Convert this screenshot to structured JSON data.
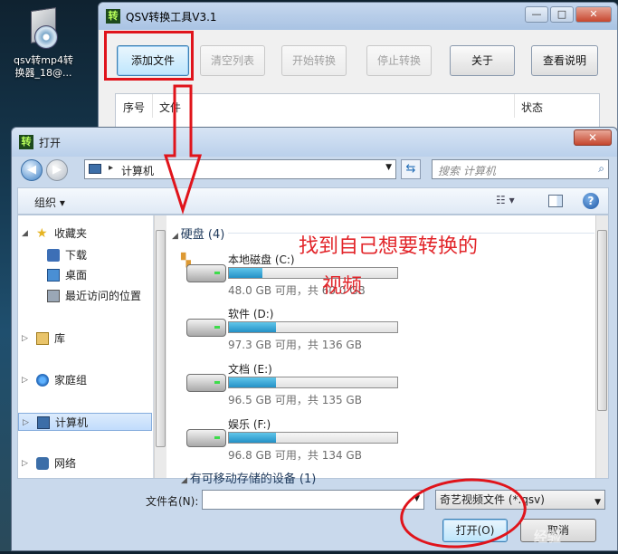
{
  "desktop_icon": {
    "label_line1": "qsv转mp4转",
    "label_line2": "换器_18@..."
  },
  "qsv_window": {
    "title": "QSV转换工具V3.1",
    "app_icon_glyph": "转",
    "controls": {
      "minimize": "—",
      "maximize": "□",
      "close": "✕"
    },
    "buttons": {
      "add_file": "添加文件",
      "clear_list": "清空列表",
      "start_convert": "开始转换",
      "stop_convert": "停止转换",
      "about": "关于",
      "view_help": "查看说明"
    },
    "list_columns": {
      "index": "序号",
      "file": "文件",
      "status": "状态"
    }
  },
  "open_dialog": {
    "title": "打开",
    "app_icon_glyph": "转",
    "close_glyph": "✕",
    "address": {
      "location": "计算机",
      "separator": "▸"
    },
    "search_placeholder": "搜索 计算机",
    "organize": "组织 ▾",
    "view_glyph": "☷ ▾",
    "help_glyph": "?",
    "nav": {
      "favorites": "收藏夹",
      "downloads": "下载",
      "desktop": "桌面",
      "recent": "最近访问的位置",
      "libraries": "库",
      "homegroup": "家庭组",
      "computer": "计算机",
      "network": "网络"
    },
    "section_hdd": "硬盘 (4)",
    "section_removable": "有可移动存储的设备 (1)",
    "drives": [
      {
        "name": "本地磁盘 (C:)",
        "info": "48.0 GB 可用，共 60.0 GB",
        "used_fraction": 0.2
      },
      {
        "name": "软件 (D:)",
        "info": "97.3 GB 可用，共 136 GB",
        "used_fraction": 0.28
      },
      {
        "name": "文档 (E:)",
        "info": "96.5 GB 可用，共 135 GB",
        "used_fraction": 0.28
      },
      {
        "name": "娱乐 (F:)",
        "info": "96.8 GB 可用，共 134 GB",
        "used_fraction": 0.28
      }
    ],
    "annotation_line1": "找到自己想要转换的",
    "annotation_line2": "视频",
    "filename_label": "文件名(N):",
    "filename_value": "",
    "filter_value": "奇艺视频文件 (*.qsv)",
    "open_button": "打开(O)",
    "cancel_button": "取消"
  },
  "watermark": "经验"
}
